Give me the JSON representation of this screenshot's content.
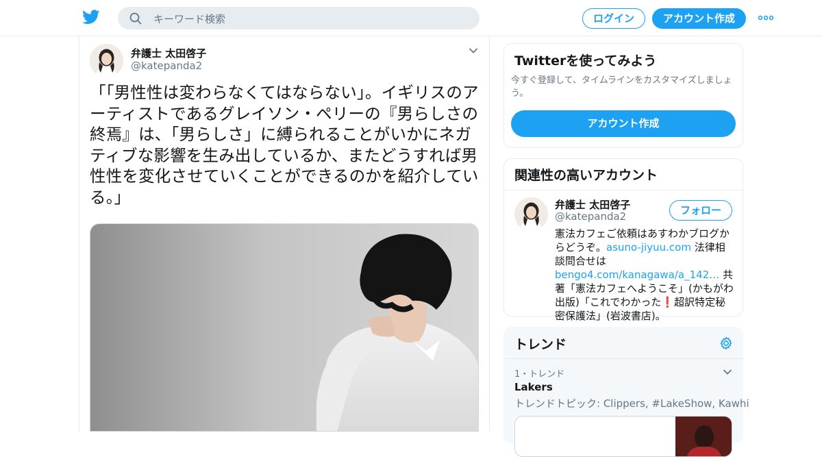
{
  "header": {
    "search_placeholder": "キーワード検索",
    "login_label": "ログイン",
    "signup_label": "アカウント作成"
  },
  "tweet": {
    "author_name": "弁護士 太田啓子",
    "author_handle": "@katepanda2",
    "text": "「「男性性は変わらなくてはならない」。イギリスのアーティストであるグレイソン・ペリーの『男らしさの終焉』は、「男らしさ」に縛られることがいかにネガティブな影響を生み出しているか、またどうすれば男性性を変化させていくことができるのかを紹介している。」"
  },
  "try_card": {
    "title": "Twitterを使ってみよう",
    "description": "今すぐ登録して、タイムラインをカスタマイズしましょう。",
    "button_label": "アカウント作成"
  },
  "related": {
    "title": "関連性の高いアカウント",
    "account_name": "弁護士 太田啓子",
    "account_handle": "@katepanda2",
    "follow_label": "フォロー",
    "bio_part1": "憲法カフェご依頼はあすわかブログからどうぞ。",
    "bio_link1": "asuno-jiyuu.com",
    "bio_part2": " 法律相談問合せは",
    "bio_link2": "bengo4.com/kanagawa/a_142…",
    "bio_part3": " 共著「憲法カフェへようこそ」(かもがわ出版)「これでわかった",
    "bio_emoji": "❗",
    "bio_part4": "超訳特定秘密保護法」(岩波書店)。"
  },
  "trends": {
    "title": "トレンド",
    "items": [
      {
        "meta": "1・トレンド",
        "name": "Lakers",
        "topics": "トレンドトピック: Clippers, #LakeShow, Kawhi"
      }
    ]
  },
  "colors": {
    "brand": "#1da1f2",
    "text": "#14171a",
    "secondary": "#657786",
    "border": "#e6ecf0"
  },
  "icons": [
    "twitter-logo-icon",
    "search-icon",
    "more-dots-icon",
    "chevron-down-icon",
    "gear-icon"
  ]
}
